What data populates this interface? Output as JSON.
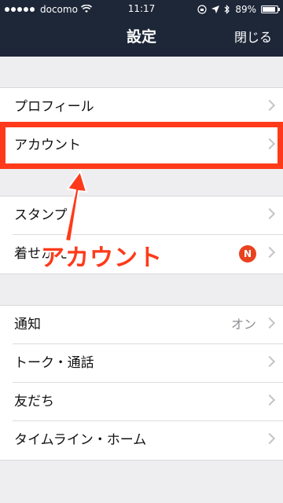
{
  "status_bar": {
    "carrier": "docomo",
    "time": "11:17",
    "battery": "89%",
    "battery_level": 0.89
  },
  "nav": {
    "title": "設定",
    "close_label": "閉じる"
  },
  "groups": [
    {
      "items": [
        {
          "label": "プロフィール"
        },
        {
          "label": "アカウント"
        }
      ]
    },
    {
      "items": [
        {
          "label": "スタンプ"
        },
        {
          "label": "着せかえ",
          "badge": "N"
        }
      ]
    },
    {
      "items": [
        {
          "label": "通知",
          "value": "オン"
        },
        {
          "label": "トーク・通話"
        },
        {
          "label": "友だち"
        },
        {
          "label": "タイムライン・ホーム"
        }
      ]
    }
  ],
  "annotation": {
    "callout_text": "アカウント",
    "highlight_color": "#ff3a1a"
  },
  "colors": {
    "header_bg": "#1e2738",
    "badge_bg": "#e9421f"
  }
}
